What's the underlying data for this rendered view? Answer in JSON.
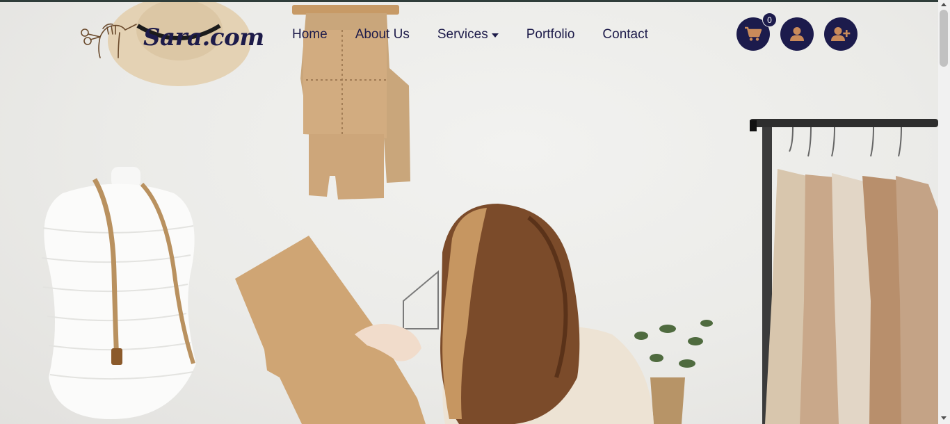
{
  "brand": {
    "name": "Sara.com",
    "logo_icon": "needle-hand-scissors-icon"
  },
  "nav": {
    "items": [
      {
        "label": "Home"
      },
      {
        "label": "About Us"
      },
      {
        "label": "Services",
        "has_dropdown": true
      },
      {
        "label": "Portfolio"
      },
      {
        "label": "Contact"
      }
    ]
  },
  "actions": {
    "cart": {
      "icon": "cart-icon",
      "count": "0"
    },
    "account": {
      "icon": "user-icon"
    },
    "register": {
      "icon": "user-plus-icon"
    }
  },
  "hero": {
    "image": "tailor-studio-photo"
  },
  "colors": {
    "brand_navy": "#1c1b4c",
    "accent_brown": "#c79a66",
    "top_bar": "#2f3d3a"
  }
}
